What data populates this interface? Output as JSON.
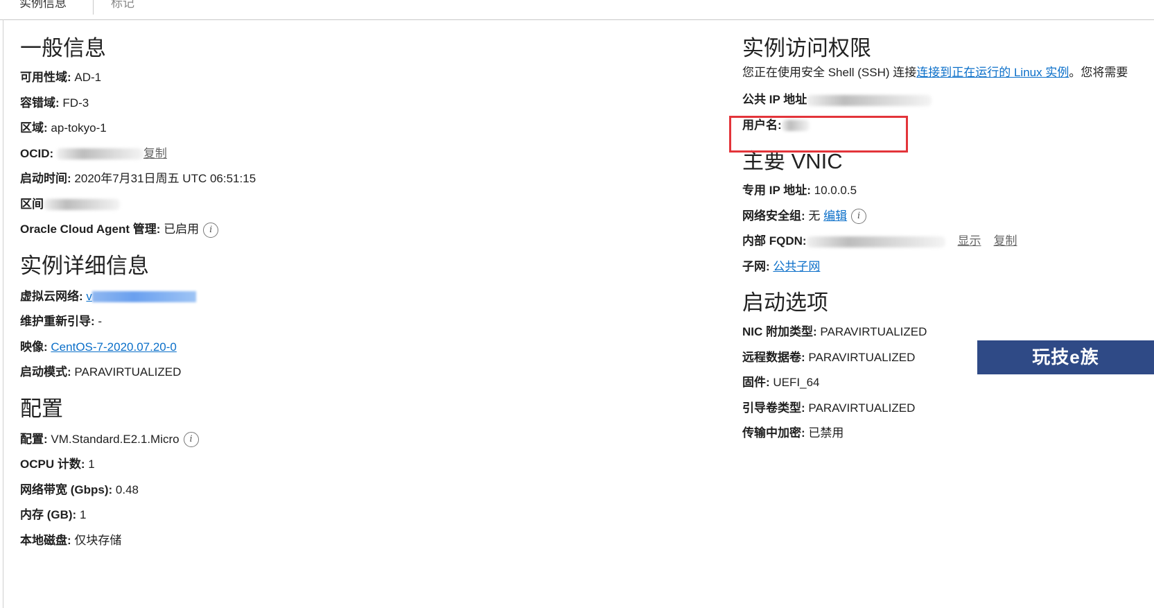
{
  "tabs": [
    {
      "label": "实例信息",
      "active": true
    },
    {
      "label": "标记",
      "active": false
    }
  ],
  "general": {
    "title": "一般信息",
    "availability_domain_label": "可用性域:",
    "availability_domain_value": "AD-1",
    "fault_domain_label": "容错域:",
    "fault_domain_value": "FD-3",
    "region_label": "区域:",
    "region_value": "ap-tokyo-1",
    "ocid_label": "OCID:",
    "ocid_copy": "复制",
    "launch_time_label": "启动时间:",
    "launch_time_value": "2020年7月31日周五 UTC 06:51:15",
    "compartment_label": "区间",
    "agent_label": "Oracle Cloud Agent 管理:",
    "agent_value": "已启用"
  },
  "details": {
    "title": "实例详细信息",
    "vcn_label": "虚拟云网络:",
    "vcn_value": "v",
    "maintenance_label": "维护重新引导:",
    "maintenance_value": "-",
    "image_label": "映像:",
    "image_value": "CentOS-7-2020.07.20-0",
    "launch_mode_label": "启动模式:",
    "launch_mode_value": "PARAVIRTUALIZED"
  },
  "config": {
    "title": "配置",
    "shape_label": "配置:",
    "shape_value": "VM.Standard.E2.1.Micro",
    "ocpu_label": "OCPU 计数:",
    "ocpu_value": "1",
    "bandwidth_label": "网络带宽 (Gbps):",
    "bandwidth_value": "0.48",
    "memory_label": "内存 (GB):",
    "memory_value": "1",
    "local_disk_label": "本地磁盘:",
    "local_disk_value": "仅块存储"
  },
  "access": {
    "title": "实例访问权限",
    "desc_prefix": "您正在使用安全 Shell (SSH) 连接",
    "desc_link": "连接到正在运行的 Linux 实例",
    "desc_suffix": "。您将需要",
    "public_ip_label": "公共 IP 地址",
    "username_label": "用户名:"
  },
  "vnic": {
    "title": "主要 VNIC",
    "private_ip_label": "专用 IP 地址:",
    "private_ip_value": "10.0.0.5",
    "nsg_label": "网络安全组:",
    "nsg_value": "无",
    "nsg_edit": "编辑",
    "fqdn_label": "内部 FQDN:",
    "fqdn_show": "显示",
    "fqdn_copy": "复制",
    "subnet_label": "子网:",
    "subnet_value": "公共子网"
  },
  "launch_options": {
    "title": "启动选项",
    "nic_label": "NIC 附加类型:",
    "nic_value": "PARAVIRTUALIZED",
    "remote_volume_label": "远程数据卷:",
    "remote_volume_value": "PARAVIRTUALIZED",
    "firmware_label": "固件:",
    "firmware_value": "UEFI_64",
    "boot_volume_label": "引导卷类型:",
    "boot_volume_value": "PARAVIRTUALIZED",
    "in_transit_label": "传输中加密:",
    "in_transit_value": "已禁用"
  },
  "watermark": "玩技e族",
  "colors": {
    "link": "#0b6fc9",
    "highlight": "#e3343a",
    "watermark_bg": "#2f4a86"
  }
}
